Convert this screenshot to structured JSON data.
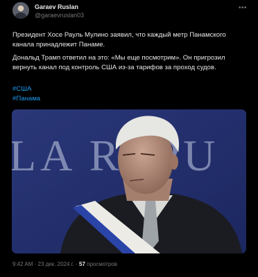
{
  "author": {
    "name": "Garaev Ruslan",
    "handle": "@garaevruslan03"
  },
  "menu_icon": "more-dots-icon",
  "text": {
    "paragraph1": "Президент Хосе Рауль Мулино заявил, что каждый метр Панамского канала принадлежит Панаме.",
    "paragraph2": "Дональд Трамп ответил на это: «Мы еще посмотрим». Он пригрозил вернуть канал под контроль США из-за тарифов за проход судов."
  },
  "hashtags": [
    "#США",
    "#Панама"
  ],
  "image": {
    "background_text": "LA REPU",
    "colors": {
      "background": "#243170",
      "sash_white": "#ecebe6",
      "sash_blue": "#2a44a8",
      "suit": "#1b1c22"
    }
  },
  "meta": {
    "time": "9:42 AM",
    "separator": "·",
    "date": "23 дек. 2024 г.",
    "views_count": "57",
    "views_label": "просмотров"
  },
  "colors": {
    "link": "#1d9bf0",
    "secondary": "#71767b",
    "text": "#e7e9ea",
    "background": "#000000"
  }
}
